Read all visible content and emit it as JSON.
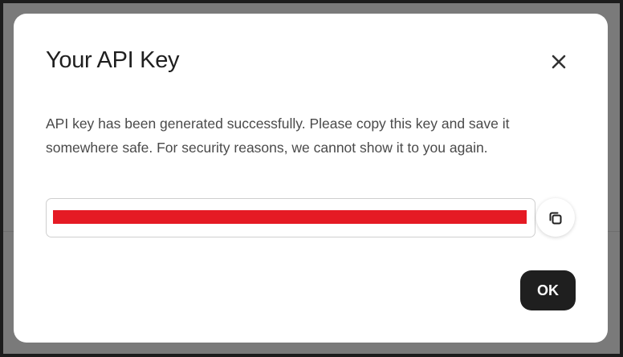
{
  "dialog": {
    "title": "Your API Key",
    "description": "API key has been generated successfully. Please copy this key and save it somewhere safe. For security reasons, we cannot show it to you again.",
    "api_key_value": "",
    "ok_label": "OK",
    "close_icon": "close-icon",
    "copy_icon": "copy-icon",
    "redaction_color": "#e51a24"
  }
}
